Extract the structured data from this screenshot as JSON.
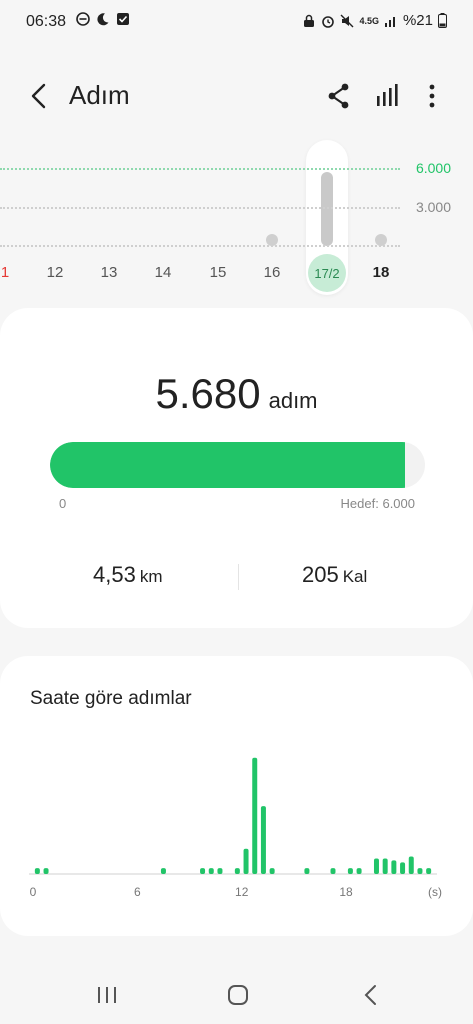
{
  "status_bar": {
    "time": "06:38",
    "network": "4.5G",
    "battery": "%21",
    "left_icons": [
      "do-not-disturb-icon",
      "moon-icon",
      "checkbox-icon"
    ],
    "right_icons": [
      "lock-icon",
      "alarm-icon",
      "mute-icon",
      "data-arrows-icon",
      "signal-icon",
      "battery-icon"
    ]
  },
  "app_bar": {
    "title": "Adım",
    "icons": [
      "back-icon",
      "share-icon",
      "bar-chart-icon",
      "more-icon"
    ]
  },
  "week_chart": {
    "gridline_labels": [
      "6.000",
      "3.000"
    ],
    "days": [
      "1",
      "12",
      "13",
      "14",
      "15",
      "16",
      "17/2",
      "18"
    ],
    "selected_day": "17/2",
    "colors": {
      "goal_line": "#21c468",
      "weekend": "#e53935",
      "inactive_dot": "#cfcfcf"
    }
  },
  "summary": {
    "steps_value": "5.680",
    "steps_unit": "adım",
    "goal": 6000,
    "steps": 5680,
    "progress_start": "0",
    "progress_goal": "Hedef: 6.000",
    "distance_value": "4,53",
    "distance_unit": "km",
    "calories_value": "205",
    "calories_unit": "Kal"
  },
  "hourly": {
    "title": "Saate göre adımlar",
    "axis_labels": [
      "0",
      "6",
      "12",
      "18",
      "(s)"
    ],
    "accent": "#21c468"
  },
  "chart_data": {
    "type": "bar",
    "title": "Saate göre adımlar",
    "xlabel": "(s)",
    "ylabel": "",
    "x": [
      0.25,
      0.75,
      7.5,
      9.75,
      10.25,
      10.75,
      11.75,
      12.25,
      12.75,
      13.25,
      13.75,
      15.75,
      17.25,
      18.25,
      18.75,
      19.75,
      20.25,
      20.75,
      21.25,
      21.75,
      22.25,
      22.75
    ],
    "values": [
      3,
      3,
      3,
      3,
      3,
      3,
      3,
      13,
      60,
      35,
      3,
      3,
      3,
      3,
      3,
      8,
      8,
      7,
      6,
      9,
      3,
      3
    ],
    "xlim": [
      0,
      23
    ],
    "x_ticks": [
      0,
      6,
      12,
      18
    ],
    "ylim": [
      0,
      65
    ],
    "grid": false
  },
  "nav_bar": {
    "icons": [
      "recent-apps-icon",
      "home-icon",
      "back-nav-icon"
    ]
  }
}
